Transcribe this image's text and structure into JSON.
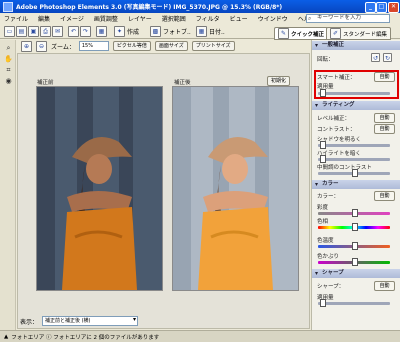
{
  "window": {
    "title": "Adobe Photoshop Elements 3.0 (写真編集モード) IMG_5370.JPG @ 15.3% (RGB/8*)",
    "buttons": {
      "min": "_",
      "max": "□",
      "close": "✕"
    }
  },
  "menu": [
    "ファイル",
    "編集",
    "イメージ",
    "画質調整",
    "レイヤー",
    "選択範囲",
    "フィルタ",
    "ビュー",
    "ウインドウ",
    "ヘルプ"
  ],
  "help_search": {
    "placeholder": "キーワードを入力"
  },
  "toolbar": {
    "create_label": "作成",
    "photo_label": "フォトブ..",
    "date_label": "日付..",
    "tab_quick": "クイック補正",
    "tab_standard": "スタンダード編集"
  },
  "options": {
    "zoom_label": "ズーム：",
    "zoom_value": "15%",
    "fit_pixels": "ピクセル等倍",
    "fit_screen": "画面サイズ",
    "print_size": "プリントサイズ"
  },
  "canvas": {
    "before_label": "補正前",
    "after_label": "補正後",
    "reset_button": "初期化"
  },
  "view": {
    "label": "表示：",
    "selected": "補正前と補正後 (横)"
  },
  "status": {
    "text": "フォトエリア ⓘ フォトエリアに 2 個のファイルがあります"
  },
  "palette": {
    "general": {
      "title": "一般補正",
      "rotate_label": "回転：",
      "smart_label": "スマート補正：",
      "auto_label": "自動",
      "amount_label": "適用量",
      "amount_value": 0.05
    },
    "lighting": {
      "title": "ライティング",
      "levels_label": "レベル補正：",
      "contrast_label": "コントラスト：",
      "shadow_label": "シャドウを明るく",
      "shadow_value": 0.05,
      "highlight_label": "ハイライトを暗く",
      "highlight_value": 0.05,
      "midtone_label": "中間調のコントラスト",
      "midtone_value": 0.5,
      "auto_label": "自動"
    },
    "color": {
      "title": "カラー",
      "color_label": "カラー：",
      "hue_label": "彩度",
      "hue_value": 0.5,
      "sat_label": "色相",
      "sat_value": 0.5,
      "temp_label": "色温度",
      "temp_value": 0.5,
      "tint_label": "色かぶり",
      "tint_value": 0.5,
      "auto_label": "自動"
    },
    "sharpen": {
      "title": "シャープ",
      "sharp_label": "シャープ：",
      "amount_label": "適用量",
      "amount_value": 0.05,
      "auto_label": "自動"
    }
  }
}
